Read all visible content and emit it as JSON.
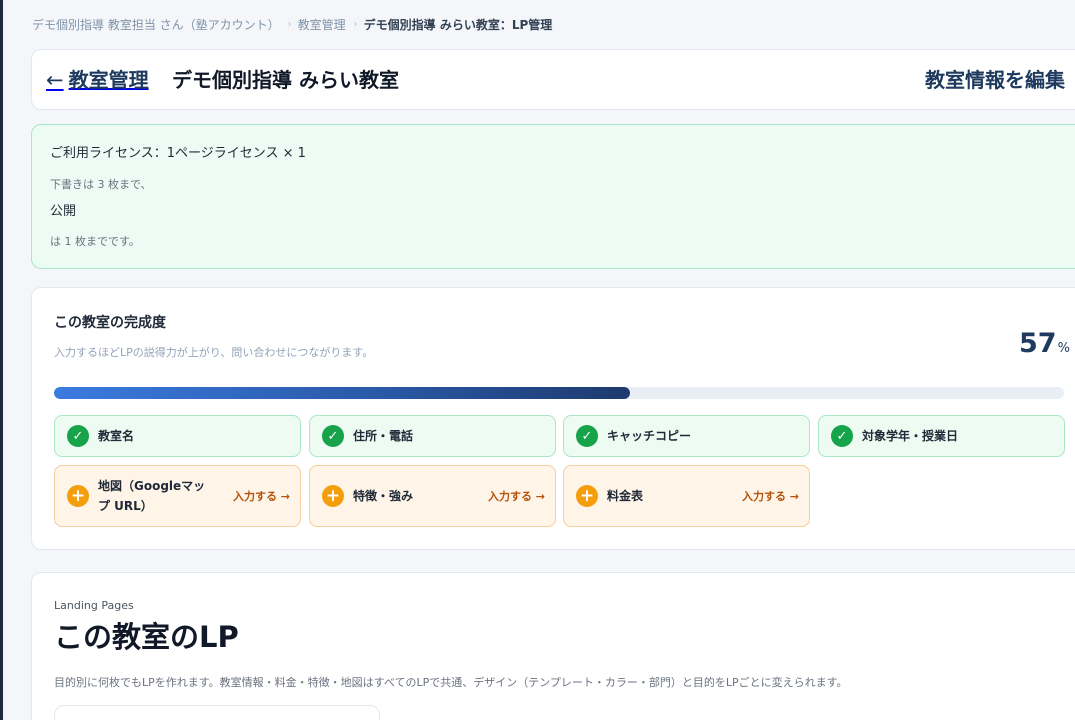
{
  "breadcrumb": {
    "items": [
      "デモ個別指導 教室担当 さん（塾アカウント）",
      "教室管理"
    ],
    "current": "デモ個別指導 みらい教室：LP管理",
    "separator": "›"
  },
  "header": {
    "back_arrow": "←",
    "back_label": "教室管理",
    "classroom_name": "デモ個別指導 みらい教室",
    "edit_label": "教室情報を編集"
  },
  "license": {
    "title": "ご利用ライセンス：1ページライセンス × 1",
    "line1": "下書きは 3 枚まで、",
    "public_label": "公開",
    "line3": "は 1 枚までです。"
  },
  "completion": {
    "title": "この教室の完成度",
    "description": "入力するほどLPの説得力が上がり、問い合わせにつながります。",
    "percent_value": "57",
    "percent_unit": "%",
    "progress": 0.57,
    "done_icon": "check-icon",
    "todo_icon": "plus-icon",
    "done_items": [
      {
        "label": "教室名"
      },
      {
        "label": "住所・電話"
      },
      {
        "label": "キャッチコピー"
      },
      {
        "label": "対象学年・授業日"
      }
    ],
    "todo_items": [
      {
        "label": "地図（Googleマップ URL）",
        "action": "入力する →"
      },
      {
        "label": "特徴・強み",
        "action": "入力する →"
      },
      {
        "label": "料金表",
        "action": "入力する →"
      }
    ]
  },
  "landing_pages": {
    "eyebrow": "Landing Pages",
    "title": "この教室のLP",
    "description": "目的別に何枚でもLPを作れます。教室情報・料金・特徴・地図はすべてのLPで共通、デザイン（テンプレート・カラー・部門）と目的をLPごとに変えられます。"
  },
  "colors": {
    "primary": "#1e3a5f",
    "success": "#16a34a",
    "warning": "#f59e0b",
    "success_bg": "#ecfbf3",
    "warning_bg": "#fff4e8",
    "progress_start": "#3b7be0",
    "progress_end": "#1e3a6e"
  }
}
